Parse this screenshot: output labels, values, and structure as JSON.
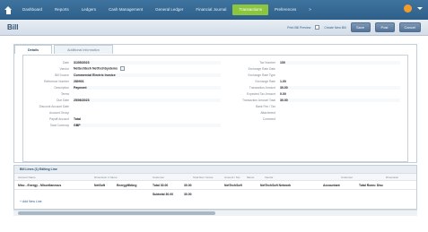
{
  "nav": {
    "items": [
      "Dashboard",
      "Reports",
      "Ledgers",
      "Cash Management",
      "General Ledger",
      "Financial Journal",
      "Transactions",
      "Preferences",
      ">"
    ]
  },
  "page": {
    "title": "Bill"
  },
  "toolbar": {
    "link_a": "Print Bill Preview",
    "link_b": "Create New Bill",
    "buttons": [
      "Save",
      "Post",
      "Cancel"
    ]
  },
  "tabs": {
    "main": "Details",
    "secondary": "Additional Information"
  },
  "details_left": [
    {
      "label": "Date",
      "value": "31/05/2023"
    },
    {
      "label": "Vendor",
      "value": "Nettechtech NetTechSystems"
    },
    {
      "label": "Bill Source",
      "value": "Commercial Electric Invoice"
    },
    {
      "label": "Reference Number",
      "value": "280901"
    },
    {
      "label": "Description",
      "value": "Payment"
    },
    {
      "label": "Terms",
      "value": ""
    },
    {
      "label": "Due Date",
      "value": "25/06/2023"
    },
    {
      "label": "Discount Account Date",
      "value": ""
    },
    {
      "label": "Account Group",
      "value": ""
    },
    {
      "label": "Payoff Account",
      "value": "Total"
    },
    {
      "label": "Total Currency",
      "value": "GBP"
    }
  ],
  "details_right": [
    {
      "label": "Tax Number",
      "value": "100"
    },
    {
      "label": "Exchange Rate Date",
      "value": ""
    },
    {
      "label": "Exchange Rate Type",
      "value": ""
    },
    {
      "label": "Exchange Rate",
      "value": "1.00"
    },
    {
      "label": "Transaction Amount",
      "value": "30.00"
    },
    {
      "label": "Expected Tax Amount",
      "value": "0.00"
    },
    {
      "label": "Transaction Amount Total",
      "value": "30.00"
    },
    {
      "label": "Bank Fee / Tax",
      "value": ""
    },
    {
      "label": "Attachment",
      "value": ""
    },
    {
      "label": "Comment",
      "value": ""
    }
  ],
  "table": {
    "title": "Bill Lines (1) Editing Line",
    "columns": [
      "Account Name",
      "Dimension 1 Name",
      "Customer",
      "Total Net / Gross",
      "Amount / Tax",
      "Memo",
      "Vendor",
      "Customer",
      "Dimension"
    ],
    "rows": [
      [
        "Misc - Energy - Miscellaneous",
        "NetSoft",
        "EnergyMkting",
        "Total 30.00",
        "30.00",
        "",
        "NetTechSoft",
        "NetTechSoft Network",
        "Accountant",
        "Total Rows: Disc"
      ],
      [
        "",
        "",
        "",
        "Subtotal 30.00",
        "30.00",
        "",
        "",
        "",
        "",
        ""
      ]
    ],
    "add_line": "+ Add New Line"
  }
}
